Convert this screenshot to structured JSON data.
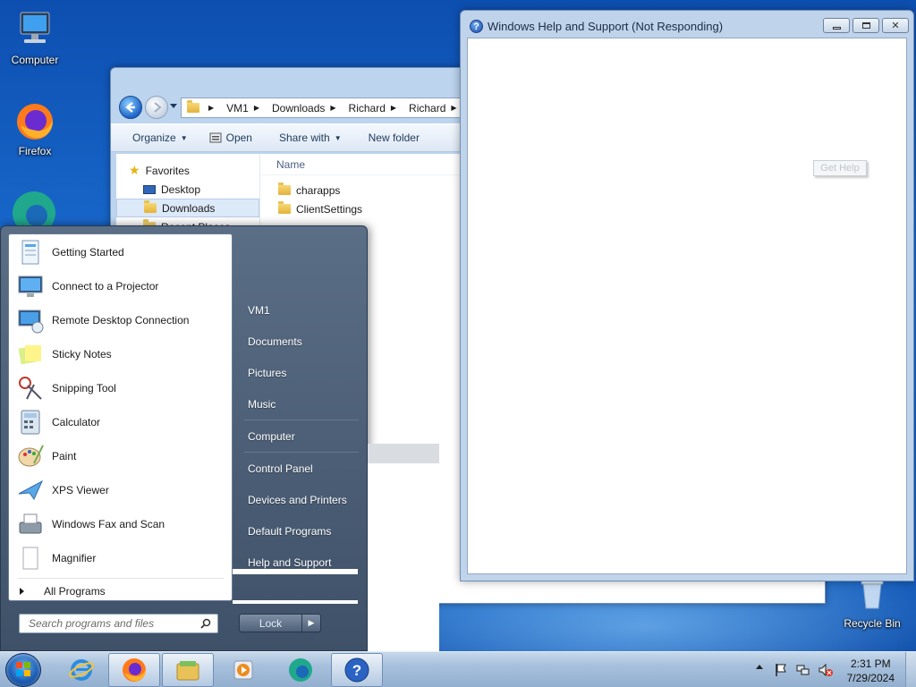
{
  "desktop": {
    "icons": [
      {
        "label": "Computer"
      },
      {
        "label": "Firefox"
      },
      {
        "label": "Recycle Bin"
      }
    ]
  },
  "explorer": {
    "breadcrumb": [
      "VM1",
      "Downloads",
      "Richard",
      "Richard"
    ],
    "toolbar": {
      "organize": "Organize",
      "open": "Open",
      "share_with": "Share with",
      "new_folder": "New folder"
    },
    "nav_pane": [
      {
        "label": "Favorites"
      },
      {
        "label": "Desktop"
      },
      {
        "label": "Downloads"
      },
      {
        "label": "Recent Places"
      }
    ],
    "column_header": "Name",
    "files": [
      {
        "name": "charapps"
      },
      {
        "name": "ClientSettings"
      }
    ]
  },
  "help_window": {
    "title": "Windows Help and Support (Not Responding)",
    "ghost_button": "Get Help"
  },
  "start_menu": {
    "programs": [
      {
        "label": "Getting Started",
        "icon": "getting-started-icon"
      },
      {
        "label": "Connect to a Projector",
        "icon": "projector-icon"
      },
      {
        "label": "Remote Desktop Connection",
        "icon": "remote-desktop-icon"
      },
      {
        "label": "Sticky Notes",
        "icon": "sticky-notes-icon"
      },
      {
        "label": "Snipping Tool",
        "icon": "scissors-icon"
      },
      {
        "label": "Calculator",
        "icon": "calculator-icon"
      },
      {
        "label": "Paint",
        "icon": "paint-palette-icon"
      },
      {
        "label": "XPS Viewer",
        "icon": "xps-viewer-icon"
      },
      {
        "label": "Windows Fax and Scan",
        "icon": "fax-scan-icon"
      },
      {
        "label": "Magnifier",
        "icon": "magnifier-icon"
      }
    ],
    "all_programs": "All Programs",
    "search_placeholder": "Search programs and files",
    "right_links": [
      {
        "label": "VM1"
      },
      {
        "label": "Documents"
      },
      {
        "label": "Pictures"
      },
      {
        "label": "Music"
      },
      {
        "label": "Computer"
      },
      {
        "label": "Control Panel"
      },
      {
        "label": "Devices and Printers"
      },
      {
        "label": "Default Programs"
      },
      {
        "label": "Help and Support"
      }
    ],
    "lock_label": "Lock"
  },
  "taskbar": {
    "items": [
      "internet-explorer-icon",
      "firefox-icon",
      "file-explorer-icon",
      "media-player-icon",
      "edge-icon",
      "help-icon"
    ],
    "clock": {
      "time": "2:31 PM",
      "date": "7/29/2024"
    }
  },
  "colors": {
    "desktop_blue": "#1a6cc4",
    "start_menu_panel": "#4a5d76",
    "taskbar": "#a6c0dc"
  }
}
